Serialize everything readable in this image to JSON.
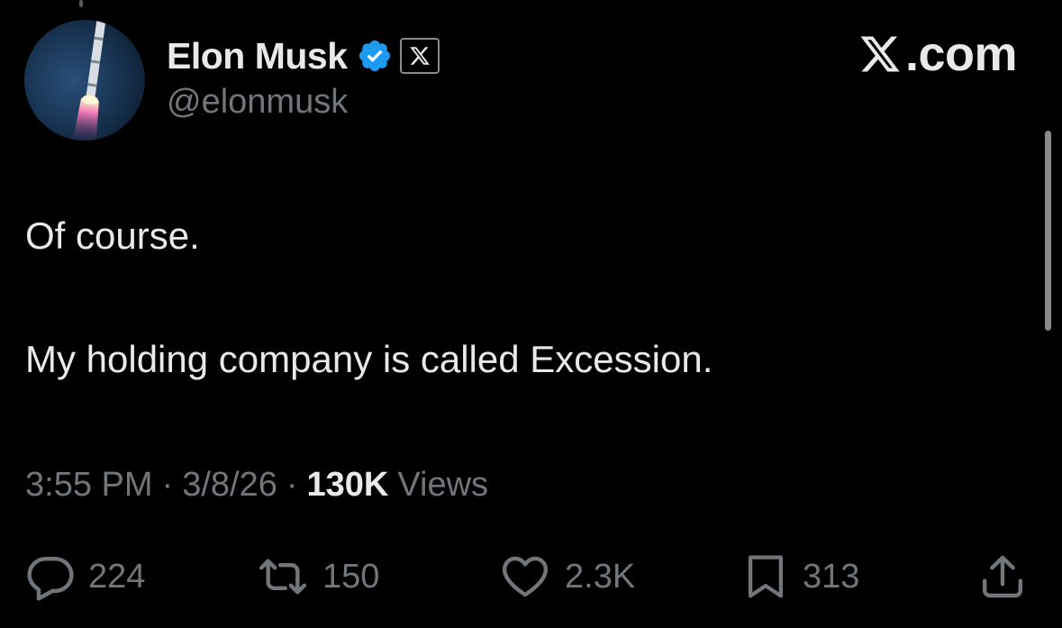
{
  "author": {
    "display_name": "Elon Musk",
    "handle": "@elonmusk",
    "verified_icon": "verified-badge-icon",
    "affiliate_icon": "x-logo-icon"
  },
  "brand": {
    "logo_icon": "x-logo-icon",
    "suffix": ".com"
  },
  "tweet": {
    "lines": [
      "Of course.",
      "My holding company is called Excession."
    ]
  },
  "meta": {
    "time": "3:55 PM",
    "separator": "·",
    "date": "3/8/26",
    "views_count": "130K",
    "views_label": "Views"
  },
  "actions": {
    "reply": {
      "icon": "reply-icon",
      "count": "224"
    },
    "retweet": {
      "icon": "retweet-icon",
      "count": "150"
    },
    "like": {
      "icon": "heart-icon",
      "count": "2.3K"
    },
    "bookmark": {
      "icon": "bookmark-icon",
      "count": "313"
    },
    "share": {
      "icon": "share-icon"
    }
  },
  "colors": {
    "background": "#000000",
    "primary_text": "#e7e9ea",
    "secondary_text": "#71767b",
    "verified_blue": "#1d9bf0"
  }
}
